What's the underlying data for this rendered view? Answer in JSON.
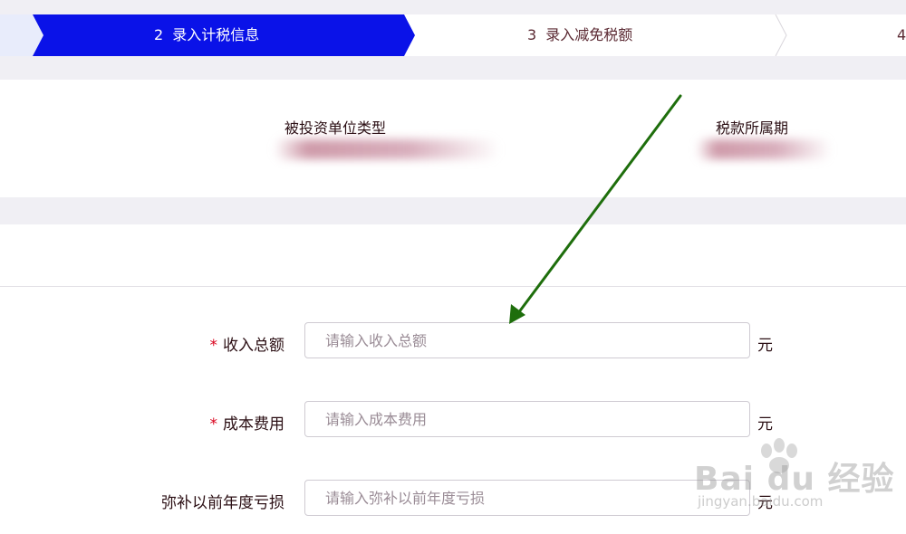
{
  "steps": [
    {
      "num": "2",
      "label": "录入计税信息",
      "active": true
    },
    {
      "num": "3",
      "label": "录入减免税额",
      "active": false
    },
    {
      "num": "4",
      "label": "",
      "active": false
    }
  ],
  "info": {
    "investee_type_label": "被投资单位类型",
    "tax_period_label": "税款所属期"
  },
  "form": {
    "rows": [
      {
        "label": "收入总额",
        "required": true,
        "placeholder": "请输入收入总额",
        "unit": "元"
      },
      {
        "label": "成本费用",
        "required": true,
        "placeholder": "请输入成本费用",
        "unit": "元"
      },
      {
        "label": "弥补以前年度亏损",
        "required": false,
        "placeholder": "请输入弥补以前年度亏损",
        "unit": "元"
      }
    ]
  },
  "required_mark": "*",
  "colors": {
    "step_active": "#0a12e8",
    "arrow": "#1e6e0c",
    "required": "#d9001b"
  },
  "watermark": {
    "brand": "Bai du 经验",
    "url": "jingyan.baidu.com"
  }
}
